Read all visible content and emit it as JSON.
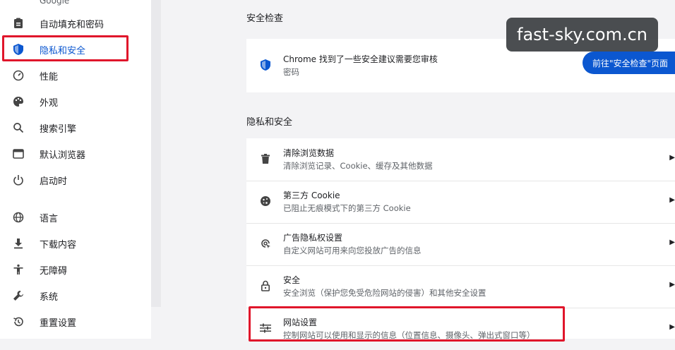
{
  "sidebar": {
    "cut_top_text": "Google",
    "items": [
      {
        "label": "自动填充和密码",
        "icon": "clipboard-icon"
      },
      {
        "label": "隐私和安全",
        "icon": "shield-icon",
        "active": true
      },
      {
        "label": "性能",
        "icon": "speedometer-icon"
      },
      {
        "label": "外观",
        "icon": "palette-icon"
      },
      {
        "label": "搜索引擎",
        "icon": "search-icon"
      },
      {
        "label": "默认浏览器",
        "icon": "browser-icon"
      },
      {
        "label": "启动时",
        "icon": "power-icon"
      },
      {
        "label": "语言",
        "icon": "globe-icon"
      },
      {
        "label": "下载内容",
        "icon": "download-icon"
      },
      {
        "label": "无障碍",
        "icon": "accessibility-icon"
      },
      {
        "label": "系统",
        "icon": "wrench-icon"
      },
      {
        "label": "重置设置",
        "icon": "history-icon"
      }
    ]
  },
  "safety_check": {
    "section_title": "安全检查",
    "title": "Chrome 找到了一些安全建议需要您审核",
    "subtitle": "密码",
    "button_label": "前往\"安全检查\"页面"
  },
  "privacy": {
    "section_title": "隐私和安全",
    "rows": [
      {
        "title": "清除浏览数据",
        "subtitle": "清除浏览记录、Cookie、缓存及其他数据",
        "icon": "trash-icon"
      },
      {
        "title": "第三方 Cookie",
        "subtitle": "已阻止无痕模式下的第三方 Cookie",
        "icon": "cookie-icon"
      },
      {
        "title": "广告隐私权设置",
        "subtitle": "自定义网站可用来向您投放广告的信息",
        "icon": "ad-privacy-icon"
      },
      {
        "title": "安全",
        "subtitle": "安全浏览（保护您免受危险网站的侵害）和其他安全设置",
        "icon": "lock-icon"
      },
      {
        "title": "网站设置",
        "subtitle": "控制网站可以使用和显示的信息（位置信息、摄像头、弹出式窗口等）",
        "icon": "sliders-icon"
      }
    ]
  },
  "watermark": "fast-sky.com.cn",
  "colors": {
    "accent": "#0b57d0",
    "highlight": "#e0162b"
  }
}
